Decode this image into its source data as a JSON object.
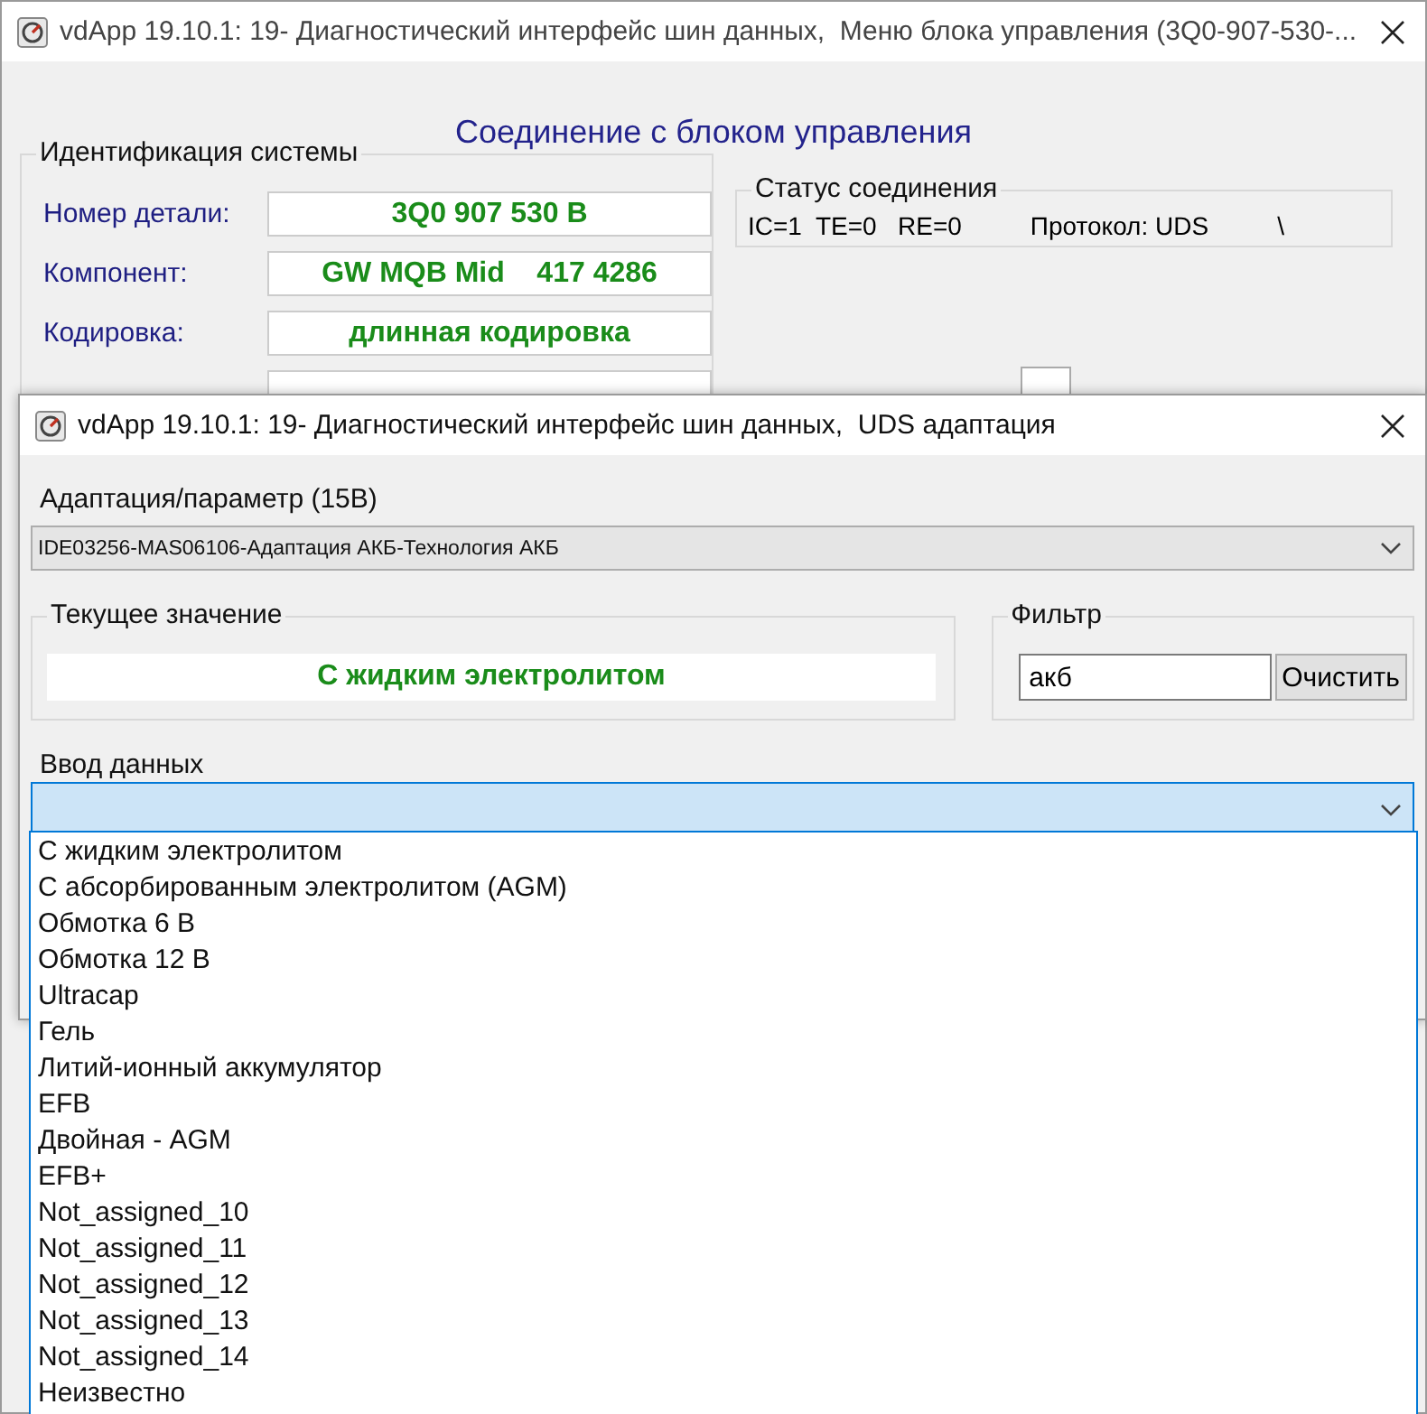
{
  "back_window": {
    "title": "vdApp 19.10.1: 19- Диагностический интерфейс шин данных,  Меню блока управления (3Q0-907-530-...",
    "heading": "Соединение с блоком управления",
    "identification": {
      "title": "Идентификация системы",
      "fields": [
        {
          "label": "Номер детали:",
          "value": "3Q0 907 530 B"
        },
        {
          "label": "Компонент:",
          "value": "GW MQB Mid    417 4286"
        },
        {
          "label": "Кодировка:",
          "value": "длинная кодировка"
        }
      ]
    },
    "connection_status": {
      "title": "Статус соединения",
      "counters": "IC=1  TE=0   RE=0",
      "protocol": "Протокол: UDS",
      "indicator": "\\"
    }
  },
  "adaptation_window": {
    "title": "vdApp 19.10.1: 19- Диагностический интерфейс шин данных,  UDS адаптация",
    "parameter": {
      "label": "Адаптация/параметр (15B)",
      "value": "IDE03256-MAS06106-Адаптация АКБ-Технология АКБ"
    },
    "current_value": {
      "label": "Текущее значение",
      "value": "С жидким электролитом"
    },
    "filter": {
      "label": "Фильтр",
      "value": "акб",
      "button": "Очистить"
    },
    "data_input": {
      "label": "Ввод данных",
      "expanded": true,
      "options": [
        {
          "text": "С жидким электролитом",
          "selected": false
        },
        {
          "text": "С абсорбированным электролитом (AGM)",
          "selected": false
        },
        {
          "text": "Обмотка 6 В",
          "selected": false
        },
        {
          "text": "Обмотка 12 В",
          "selected": false
        },
        {
          "text": "Ultracap",
          "selected": false
        },
        {
          "text": "Гель",
          "selected": false
        },
        {
          "text": "Литий-ионный аккумулятор",
          "selected": false
        },
        {
          "text": "EFB",
          "selected": false
        },
        {
          "text": "Двойная - AGM",
          "selected": false
        },
        {
          "text": "EFB+",
          "selected": false
        },
        {
          "text": "Not_assigned_10",
          "selected": false
        },
        {
          "text": "Not_assigned_11",
          "selected": false
        },
        {
          "text": "Not_assigned_12",
          "selected": false
        },
        {
          "text": "Not_assigned_13",
          "selected": false
        },
        {
          "text": "Not_assigned_14",
          "selected": false
        },
        {
          "text": "Неизвестно",
          "selected": false
        }
      ]
    }
  }
}
